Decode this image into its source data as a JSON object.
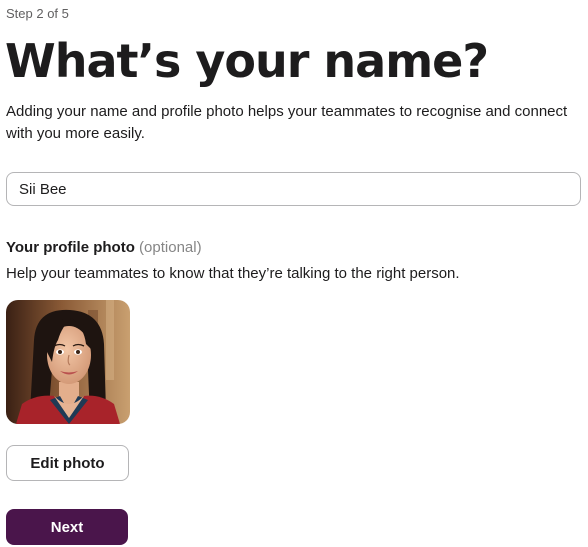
{
  "step_indicator": "Step 2 of 5",
  "heading": "What’s your name?",
  "subtitle": "Adding your name and profile photo helps your teammates to recognise and connect with you more easily.",
  "name_field": {
    "value": "Sii Bee"
  },
  "profile_photo": {
    "label": "Your profile photo",
    "optional": "(optional)",
    "help": "Help your teammates to know that they’re talking to the right person."
  },
  "buttons": {
    "edit_photo": "Edit photo",
    "next": "Next"
  },
  "colors": {
    "primary_button": "#4a154b",
    "text": "#1d1c1d",
    "muted": "#868686",
    "border": "#b5b5b7"
  }
}
